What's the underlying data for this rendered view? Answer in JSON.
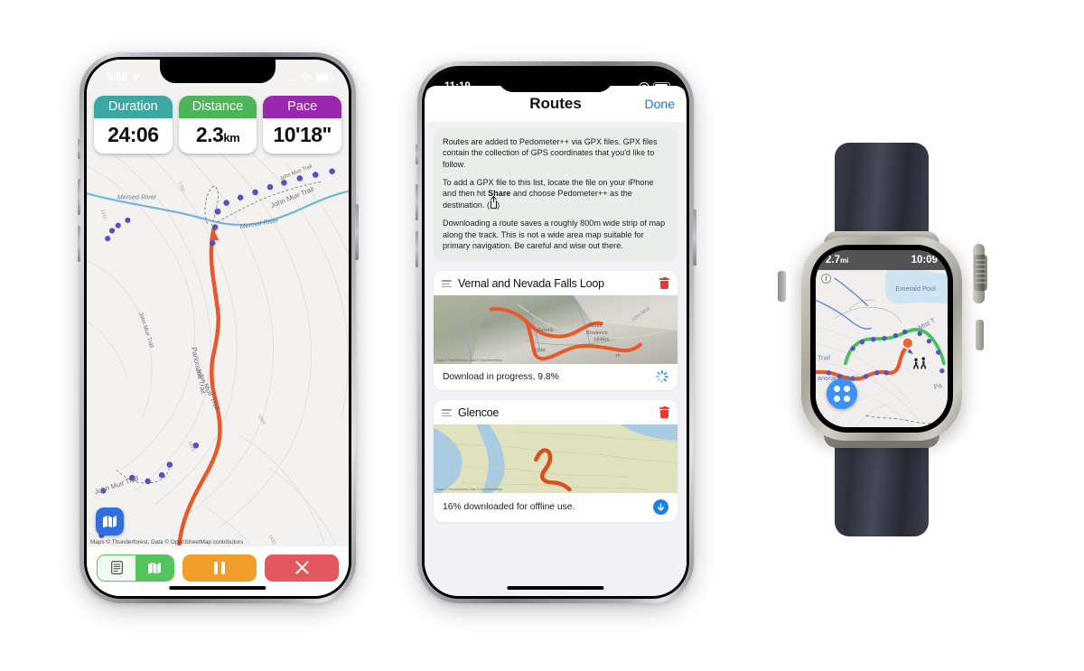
{
  "scene": {
    "description": "Pedometer++ app shown on two iPhones and an Apple Watch Ultra"
  },
  "phone1": {
    "status_bar": {
      "time": "8:58",
      "location_icon": "location-arrow-icon",
      "cellular": "....",
      "wifi": "wifi-icon",
      "battery": "battery-icon"
    },
    "stats": [
      {
        "label": "Duration",
        "value": "24:06",
        "unit": "",
        "color": "#3ca8a3"
      },
      {
        "label": "Distance",
        "value": "2.3",
        "unit": "km",
        "color": "#4cb558"
      },
      {
        "label": "Pace",
        "value": "10'18\"",
        "unit": "",
        "color": "#9b27b0"
      }
    ],
    "map": {
      "attribution": "Maps © Thunderforest, Data © OpenStreetMap contributors",
      "mapkit_badge_icon": "maps-icon",
      "labels": [
        "Merced River",
        "Merced River",
        "John Muir Trail",
        "John Muir Trail",
        "John Muir Trail",
        "John Muir Trail",
        "Panorama Trail"
      ],
      "contours": [
        "1780",
        "1810",
        "1870",
        "1880",
        "1890",
        "1930",
        "1930"
      ],
      "route_color": "#e8582a",
      "waypoint_color": "#5b4fc4",
      "water_color": "#6fb4dd"
    },
    "toolbar": {
      "segment_list_icon": "list-icon",
      "segment_map_icon": "map-icon",
      "segment_selected": "map",
      "pause_label": "pause-icon",
      "stop_label": "close-icon",
      "pause_color": "#f0a02a",
      "stop_color": "#e5575e",
      "segment_accent": "#56c45c"
    }
  },
  "phone2": {
    "status_bar": {
      "time": "11:19",
      "cellular": "....",
      "wifi": "wifi-icon",
      "battery": "battery-icon"
    },
    "nav": {
      "title": "Routes",
      "done_label": "Done",
      "done_color": "#0a74f0"
    },
    "info": {
      "p1": "Routes are added to Pedometer++ via GPX files. GPX files contain the collection of GPS coordinates that you'd like to follow.",
      "p2_a": "To add a GPX file to this list, locate the file on your iPhone and then hit ",
      "p2_b": "Share",
      "p2_c": " and choose Pedometer++ as the destination. (",
      "p2_d": ")",
      "p3": "Downloading a route saves a roughly 800m wide strip of map along the track. This is not a wide area map suitable for primary navigation. Be careful and wise out there."
    },
    "routes": [
      {
        "title": "Vernal and Nevada Falls Loop",
        "status": "Download in progress, 9.8%",
        "action_icon": "spinner-icon",
        "drag_icon": "drag-handle-icon",
        "delete_icon": "trash-icon",
        "thumb_labels": [
          "Mount",
          "Broderick",
          "Grizzly",
          "John Muir",
          "1846",
          "m"
        ],
        "thumb_attribution": "Maps © Thunderforest, Data © OpenStreetMap"
      },
      {
        "title": "Glencoe",
        "status": "16% downloaded for offline use.",
        "action_icon": "download-icon",
        "drag_icon": "drag-handle-icon",
        "delete_icon": "trash-icon",
        "thumb_labels": [],
        "thumb_attribution": "Maps © Thunderforest, Data © OpenStreetMap"
      }
    ]
  },
  "watch": {
    "status_bar": {
      "distance": "2.7",
      "distance_unit": "mi",
      "time": "10:09"
    },
    "map": {
      "labels": [
        "Emerald Pool",
        "Mist T",
        "t Trail",
        "Panorama Trail",
        "Pa"
      ],
      "route_done_color": "#3fc35a",
      "route_active_color": "#e8582a",
      "waypoint_color": "#5b4fc4",
      "position_color": "#f2622a",
      "water_color": "#cfe4f2",
      "compass_icon": "compass-icon"
    },
    "grid_button": {
      "icon": "grid-icon",
      "color": "#3d93f5"
    },
    "hardware": {
      "crown_icon": "digital-crown",
      "side_button_icon": "side-button",
      "action_button_icon": "action-button"
    }
  }
}
